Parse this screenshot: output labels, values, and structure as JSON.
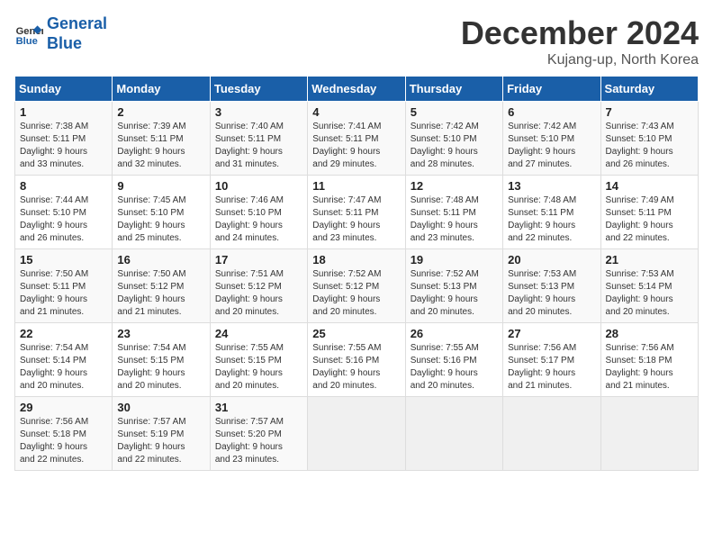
{
  "header": {
    "logo_line1": "General",
    "logo_line2": "Blue",
    "title": "December 2024",
    "subtitle": "Kujang-up, North Korea"
  },
  "weekdays": [
    "Sunday",
    "Monday",
    "Tuesday",
    "Wednesday",
    "Thursday",
    "Friday",
    "Saturday"
  ],
  "weeks": [
    [
      {
        "day": "1",
        "info": "Sunrise: 7:38 AM\nSunset: 5:11 PM\nDaylight: 9 hours\nand 33 minutes."
      },
      {
        "day": "2",
        "info": "Sunrise: 7:39 AM\nSunset: 5:11 PM\nDaylight: 9 hours\nand 32 minutes."
      },
      {
        "day": "3",
        "info": "Sunrise: 7:40 AM\nSunset: 5:11 PM\nDaylight: 9 hours\nand 31 minutes."
      },
      {
        "day": "4",
        "info": "Sunrise: 7:41 AM\nSunset: 5:11 PM\nDaylight: 9 hours\nand 29 minutes."
      },
      {
        "day": "5",
        "info": "Sunrise: 7:42 AM\nSunset: 5:10 PM\nDaylight: 9 hours\nand 28 minutes."
      },
      {
        "day": "6",
        "info": "Sunrise: 7:42 AM\nSunset: 5:10 PM\nDaylight: 9 hours\nand 27 minutes."
      },
      {
        "day": "7",
        "info": "Sunrise: 7:43 AM\nSunset: 5:10 PM\nDaylight: 9 hours\nand 26 minutes."
      }
    ],
    [
      {
        "day": "8",
        "info": "Sunrise: 7:44 AM\nSunset: 5:10 PM\nDaylight: 9 hours\nand 26 minutes."
      },
      {
        "day": "9",
        "info": "Sunrise: 7:45 AM\nSunset: 5:10 PM\nDaylight: 9 hours\nand 25 minutes."
      },
      {
        "day": "10",
        "info": "Sunrise: 7:46 AM\nSunset: 5:10 PM\nDaylight: 9 hours\nand 24 minutes."
      },
      {
        "day": "11",
        "info": "Sunrise: 7:47 AM\nSunset: 5:11 PM\nDaylight: 9 hours\nand 23 minutes."
      },
      {
        "day": "12",
        "info": "Sunrise: 7:48 AM\nSunset: 5:11 PM\nDaylight: 9 hours\nand 23 minutes."
      },
      {
        "day": "13",
        "info": "Sunrise: 7:48 AM\nSunset: 5:11 PM\nDaylight: 9 hours\nand 22 minutes."
      },
      {
        "day": "14",
        "info": "Sunrise: 7:49 AM\nSunset: 5:11 PM\nDaylight: 9 hours\nand 22 minutes."
      }
    ],
    [
      {
        "day": "15",
        "info": "Sunrise: 7:50 AM\nSunset: 5:11 PM\nDaylight: 9 hours\nand 21 minutes."
      },
      {
        "day": "16",
        "info": "Sunrise: 7:50 AM\nSunset: 5:12 PM\nDaylight: 9 hours\nand 21 minutes."
      },
      {
        "day": "17",
        "info": "Sunrise: 7:51 AM\nSunset: 5:12 PM\nDaylight: 9 hours\nand 20 minutes."
      },
      {
        "day": "18",
        "info": "Sunrise: 7:52 AM\nSunset: 5:12 PM\nDaylight: 9 hours\nand 20 minutes."
      },
      {
        "day": "19",
        "info": "Sunrise: 7:52 AM\nSunset: 5:13 PM\nDaylight: 9 hours\nand 20 minutes."
      },
      {
        "day": "20",
        "info": "Sunrise: 7:53 AM\nSunset: 5:13 PM\nDaylight: 9 hours\nand 20 minutes."
      },
      {
        "day": "21",
        "info": "Sunrise: 7:53 AM\nSunset: 5:14 PM\nDaylight: 9 hours\nand 20 minutes."
      }
    ],
    [
      {
        "day": "22",
        "info": "Sunrise: 7:54 AM\nSunset: 5:14 PM\nDaylight: 9 hours\nand 20 minutes."
      },
      {
        "day": "23",
        "info": "Sunrise: 7:54 AM\nSunset: 5:15 PM\nDaylight: 9 hours\nand 20 minutes."
      },
      {
        "day": "24",
        "info": "Sunrise: 7:55 AM\nSunset: 5:15 PM\nDaylight: 9 hours\nand 20 minutes."
      },
      {
        "day": "25",
        "info": "Sunrise: 7:55 AM\nSunset: 5:16 PM\nDaylight: 9 hours\nand 20 minutes."
      },
      {
        "day": "26",
        "info": "Sunrise: 7:55 AM\nSunset: 5:16 PM\nDaylight: 9 hours\nand 20 minutes."
      },
      {
        "day": "27",
        "info": "Sunrise: 7:56 AM\nSunset: 5:17 PM\nDaylight: 9 hours\nand 21 minutes."
      },
      {
        "day": "28",
        "info": "Sunrise: 7:56 AM\nSunset: 5:18 PM\nDaylight: 9 hours\nand 21 minutes."
      }
    ],
    [
      {
        "day": "29",
        "info": "Sunrise: 7:56 AM\nSunset: 5:18 PM\nDaylight: 9 hours\nand 22 minutes."
      },
      {
        "day": "30",
        "info": "Sunrise: 7:57 AM\nSunset: 5:19 PM\nDaylight: 9 hours\nand 22 minutes."
      },
      {
        "day": "31",
        "info": "Sunrise: 7:57 AM\nSunset: 5:20 PM\nDaylight: 9 hours\nand 23 minutes."
      },
      {
        "day": "",
        "info": ""
      },
      {
        "day": "",
        "info": ""
      },
      {
        "day": "",
        "info": ""
      },
      {
        "day": "",
        "info": ""
      }
    ]
  ]
}
